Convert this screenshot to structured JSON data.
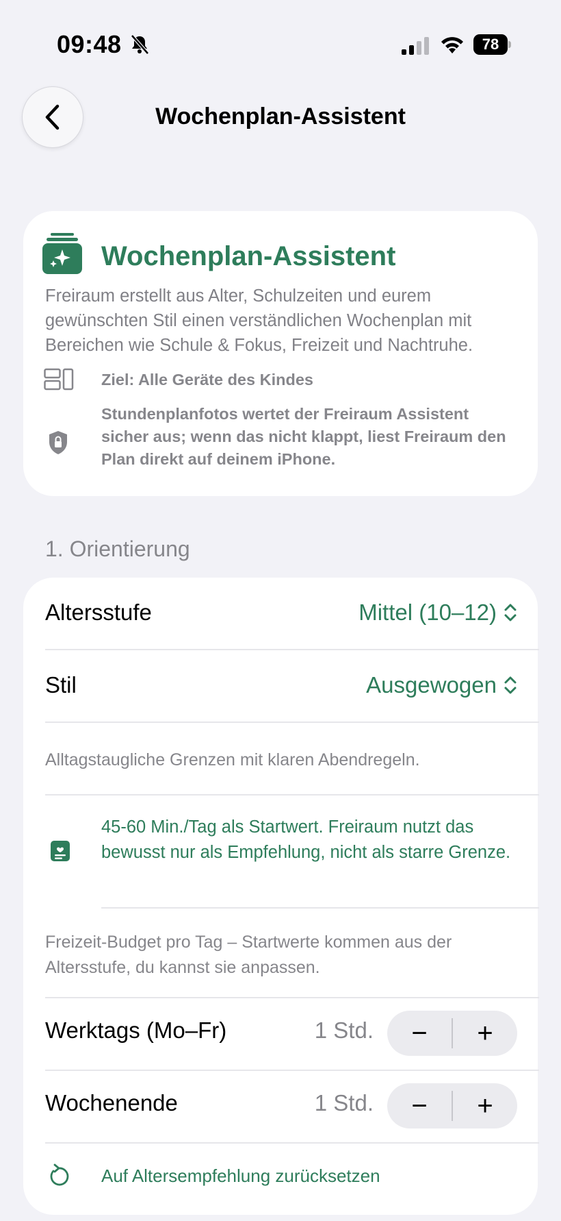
{
  "status_bar": {
    "time": "09:48",
    "battery": "78"
  },
  "nav": {
    "title": "Wochenplan-Assistent"
  },
  "hero": {
    "title": "Wochenplan-Assistent",
    "description": "Freiraum erstellt aus Alter, Schulzeiten und eurem gewünschten Stil einen verständlichen Wochenplan mit Bereichen wie Schule & Fokus, Freizeit und Nachtruhe.",
    "target": "Ziel: Alle Geräte des Kindes",
    "privacy": "Stundenplanfotos wertet der Freiraum Assistent sicher aus; wenn das nicht klappt, liest Freiraum den Plan direkt auf deinem iPhone."
  },
  "section": {
    "header": "1. Orientierung"
  },
  "settings": {
    "age_label": "Altersstufe",
    "age_value": "Mittel (10–12)",
    "style_label": "Stil",
    "style_value": "Ausgewogen",
    "style_description": "Alltagstaugliche Grenzen mit klaren Abendregeln.",
    "tip": "45-60 Min./Tag als Startwert. Freiraum nutzt das bewusst nur als Empfehlung, nicht als starre Grenze.",
    "budget_note": "Freizeit-Budget pro Tag – Startwerte kommen aus der Altersstufe, du kannst sie anpassen.",
    "weekdays_label": "Werktags (Mo–Fr)",
    "weekdays_value": "1 Std.",
    "weekend_label": "Wochenende",
    "weekend_value": "1 Std.",
    "minus": "−",
    "plus": "+",
    "reset_label": "Auf Altersempfehlung zurücksetzen"
  },
  "colors": {
    "accent": "#2e7d5b",
    "secondary_text": "#86868b",
    "background": "#f2f2f7"
  }
}
